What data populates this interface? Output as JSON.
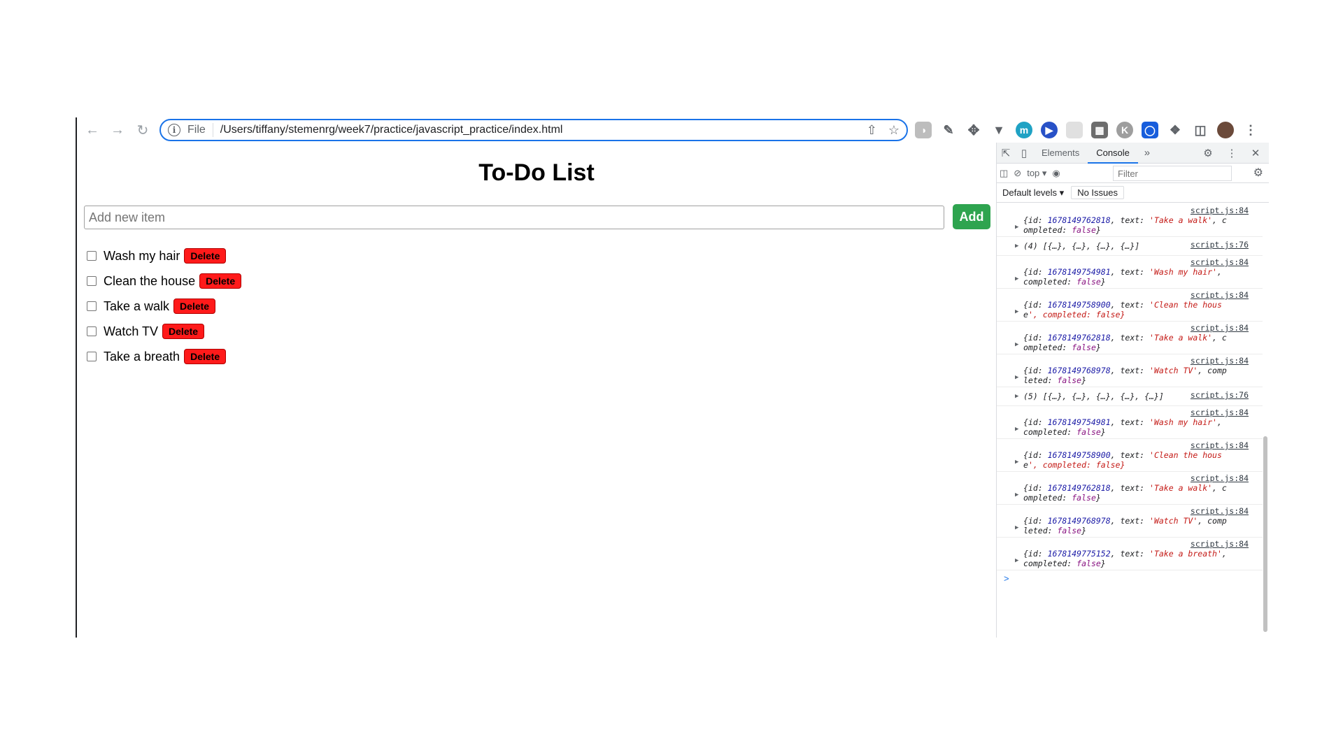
{
  "browser": {
    "address": {
      "scheme": "File",
      "url": "/Users/tiffany/stemenrg/week7/practice/javascript_practice/index.html"
    }
  },
  "app": {
    "title": "To-Do List",
    "input_placeholder": "Add new item",
    "add_label": "Add",
    "items": [
      {
        "text": "Wash my hair",
        "completed": false,
        "delete_label": "Delete"
      },
      {
        "text": "Clean the house",
        "completed": false,
        "delete_label": "Delete"
      },
      {
        "text": "Take a walk",
        "completed": false,
        "delete_label": "Delete"
      },
      {
        "text": "Watch TV",
        "completed": false,
        "delete_label": "Delete"
      },
      {
        "text": "Take a breath",
        "completed": false,
        "delete_label": "Delete"
      }
    ]
  },
  "devtools": {
    "tabs": [
      "Elements",
      "Console"
    ],
    "active_tab": "Console",
    "context": "top",
    "filter_placeholder": "Filter",
    "levels_label": "Default levels",
    "issues_label": "No Issues",
    "logs": [
      {
        "source": "script.js:84",
        "line1": "{id: 1678149762818, text: 'Take a walk', c",
        "line2": "ompleted: false}"
      },
      {
        "source": "script.js:76",
        "line1": "(4) [{…}, {…}, {…}, {…}]",
        "line2": ""
      },
      {
        "source": "script.js:84",
        "line1": "{id: 1678149754981, text: 'Wash my hair',",
        "line2": "completed: false}"
      },
      {
        "source": "script.js:84",
        "line1": "{id: 1678149758900, text: 'Clean the hous",
        "line2": "e', completed: false}"
      },
      {
        "source": "script.js:84",
        "line1": "{id: 1678149762818, text: 'Take a walk', c",
        "line2": "ompleted: false}"
      },
      {
        "source": "script.js:84",
        "line1": "{id: 1678149768978, text: 'Watch TV', comp",
        "line2": "leted: false}"
      },
      {
        "source": "script.js:76",
        "line1": "(5) [{…}, {…}, {…}, {…}, {…}]",
        "line2": ""
      },
      {
        "source": "script.js:84",
        "line1": "{id: 1678149754981, text: 'Wash my hair',",
        "line2": "completed: false}"
      },
      {
        "source": "script.js:84",
        "line1": "{id: 1678149758900, text: 'Clean the hous",
        "line2": "e', completed: false}"
      },
      {
        "source": "script.js:84",
        "line1": "{id: 1678149762818, text: 'Take a walk', c",
        "line2": "ompleted: false}"
      },
      {
        "source": "script.js:84",
        "line1": "{id: 1678149768978, text: 'Watch TV', comp",
        "line2": "leted: false}"
      },
      {
        "source": "script.js:84",
        "line1": "{id: 1678149775152, text: 'Take a breath',",
        "line2": "completed: false}"
      }
    ],
    "prompt": ">"
  }
}
